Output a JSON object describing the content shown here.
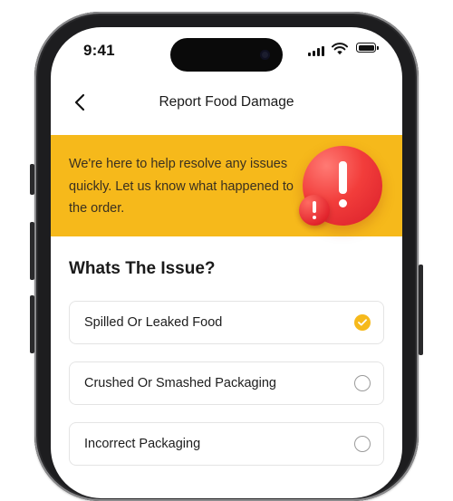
{
  "status_bar": {
    "time": "9:41"
  },
  "header": {
    "title": "Report Food Damage"
  },
  "banner": {
    "message": "We're here to help resolve any issues quickly. Let us know what happened to the order."
  },
  "issue_section": {
    "title": "Whats The Issue?",
    "options": [
      {
        "label": "Spilled Or Leaked Food",
        "selected": true
      },
      {
        "label": "Crushed Or Smashed Packaging",
        "selected": false
      },
      {
        "label": "Incorrect Packaging",
        "selected": false
      }
    ]
  },
  "colors": {
    "accent": "#f6b91b",
    "alert": "#e3262e"
  }
}
